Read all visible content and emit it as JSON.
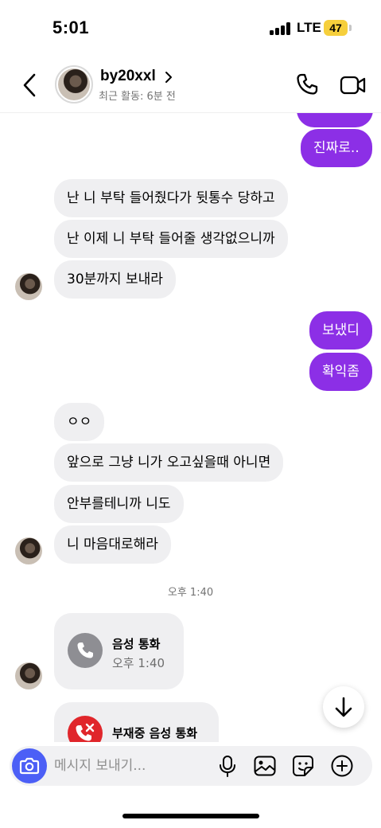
{
  "status_bar": {
    "time": "5:01",
    "network": "LTE",
    "battery": "47"
  },
  "header": {
    "contact_name": "by20xxl",
    "activity": "최근 활동: 6분 전",
    "icons": [
      "back-chevron-icon",
      "chevron-right-icon",
      "phone-icon",
      "video-camera-icon"
    ]
  },
  "messages": {
    "out_1": "진짜로..",
    "in_1": "난 니 부탁 들어줬다가 뒷통수 당하고",
    "in_2": "난 이제 니 부탁 들어줄 생각없으니까",
    "in_3": "30분까지 보내라",
    "out_2": "보냈디",
    "out_3": "확익좀",
    "in_4": "ㅇㅇ",
    "in_5": "앞으로 그냥 니가 오고싶을때 아니면",
    "in_6": "안부를테니까 니도",
    "in_7": "니 마음대로해라",
    "timestamp": "오후 1:40",
    "voice_call_title": "음성 통화",
    "voice_call_time": "오후 1:40",
    "missed_call_title": "부재중 음성 통화"
  },
  "composer": {
    "placeholder": "메시지 보내기...",
    "icons": [
      "camera-icon",
      "microphone-icon",
      "image-icon",
      "sticker-icon",
      "plus-circle-icon"
    ]
  },
  "colors": {
    "outgoing_bubble": "#8c2fe6",
    "incoming_bubble": "#efeff1",
    "camera_button": "#4c5ff6",
    "missed_call": "#e0262b",
    "battery": "#f6cf3c"
  }
}
